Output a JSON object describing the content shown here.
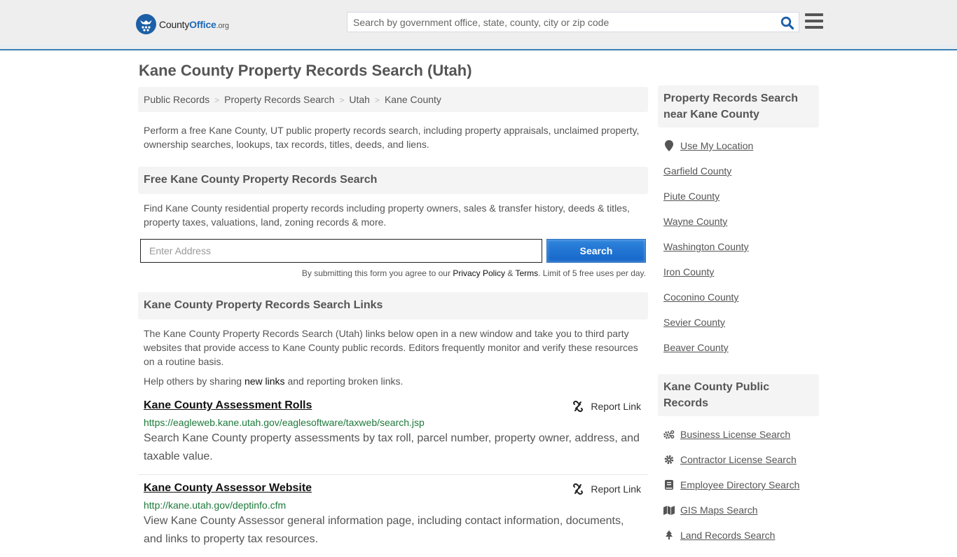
{
  "header": {
    "logo": {
      "county": "County",
      "office": "Office",
      "tld": ".org"
    },
    "search_placeholder": "Search by government office, state, county, city or zip code",
    "search_icon": "search-icon",
    "menu_icon": "hamburger-menu-icon"
  },
  "page": {
    "title": "Kane County Property Records Search (Utah)"
  },
  "breadcrumb": [
    {
      "label": "Public Records"
    },
    {
      "label": "Property Records Search"
    },
    {
      "label": "Utah"
    },
    {
      "label": "Kane County"
    }
  ],
  "breadcrumb_separator": ">",
  "intro": "Perform a free Kane County, UT public property records search, including property appraisals, unclaimed property, ownership searches, lookups, tax records, titles, deeds, and liens.",
  "free_search": {
    "heading": "Free Kane County Property Records Search",
    "text": "Find Kane County residential property records including property owners, sales & transfer history, deeds & titles, property taxes, valuations, land, zoning records & more.",
    "input_placeholder": "Enter Address",
    "button_label": "Search",
    "disclaimer_prefix": "By submitting this form you agree to our ",
    "privacy_label": "Privacy Policy",
    "amp": " & ",
    "terms_label": "Terms",
    "disclaimer_suffix": ". Limit of 5 free uses per day."
  },
  "links_section": {
    "heading": "Kane County Property Records Search Links",
    "text": "The Kane County Property Records Search (Utah) links below open in a new window and take you to third party websites that provide access to Kane County public records. Editors frequently monitor and verify these resources on a routine basis.",
    "help_prefix": "Help others by sharing ",
    "help_link": "new links",
    "help_suffix": " and reporting broken links.",
    "report_label": "Report Link",
    "results": [
      {
        "title": "Kane County Assessment Rolls",
        "url": "https://eagleweb.kane.utah.gov/eaglesoftware/taxweb/search.jsp",
        "description": "Search Kane County property assessments by tax roll, parcel number, property owner, address, and taxable value."
      },
      {
        "title": "Kane County Assessor Website",
        "url": "http://kane.utah.gov/deptinfo.cfm",
        "description": "View Kane County Assessor general information page, including contact information, documents, and links to property tax resources."
      }
    ]
  },
  "sidebar": {
    "nearby": {
      "heading": "Property Records Search near Kane County",
      "use_location": "Use My Location",
      "counties": [
        "Garfield County",
        "Piute County",
        "Wayne County",
        "Washington County",
        "Iron County",
        "Coconino County",
        "Sevier County",
        "Beaver County"
      ]
    },
    "public_records": {
      "heading": "Kane County Public Records",
      "items": [
        {
          "label": "Business License Search",
          "icon": "cogs-icon"
        },
        {
          "label": "Contractor License Search",
          "icon": "gear-icon"
        },
        {
          "label": "Employee Directory Search",
          "icon": "book-icon"
        },
        {
          "label": "GIS Maps Search",
          "icon": "map-icon"
        },
        {
          "label": "Land Records Search",
          "icon": "tree-icon"
        }
      ]
    }
  },
  "colors": {
    "brand_blue": "#1d6bb8",
    "header_border": "#3a7fb5",
    "url_green": "#1d7a3a",
    "button_blue": "#1466c8"
  }
}
